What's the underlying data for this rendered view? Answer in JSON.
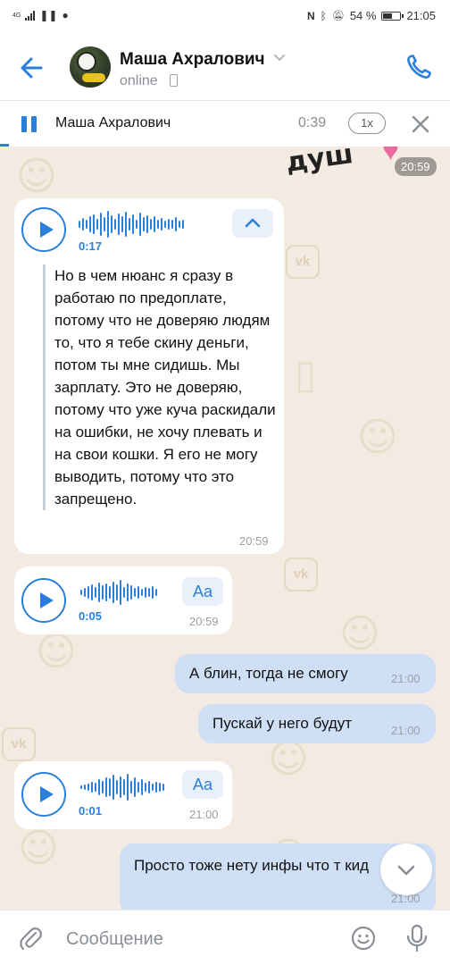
{
  "statusbar": {
    "network_label": "4G",
    "battery": "54 %",
    "battery_level": 0.54,
    "time": "21:05"
  },
  "header": {
    "contact_name": "Маша Ахралович",
    "status": "online"
  },
  "player": {
    "name": "Маша Ахралович",
    "time": "0:39",
    "speed": "1x",
    "progress": 0.02
  },
  "chat": {
    "sticker": {
      "text": "душ",
      "time": "20:59"
    },
    "messages": [
      {
        "type": "voice",
        "direction": "in",
        "duration": "0:17",
        "transcript": "Но в чем нюанс я сразу в работаю по предоплате, потому что не доверяю людям то, что я тебе скину деньги, потом ты мне сидишь. Мы зарплату. Это не доверяю, потому что уже куча раскидали на ошибки, не хочу плевать и на свои кошки. Я его не могу выводить, потому что это запрещено.",
        "time": "20:59"
      },
      {
        "type": "voice",
        "direction": "in",
        "duration": "0:05",
        "aa_label": "Aa",
        "time": "20:59"
      },
      {
        "type": "text",
        "direction": "out",
        "text": "А блин, тогда не смогу",
        "time": "21:00"
      },
      {
        "type": "text",
        "direction": "out",
        "text": "Пускай у него будут",
        "time": "21:00"
      },
      {
        "type": "voice",
        "direction": "in",
        "duration": "0:01",
        "aa_label": "Aa",
        "time": "21:00"
      },
      {
        "type": "text",
        "direction": "out",
        "text": "Просто тоже нету инфы что т кид",
        "time": "21:00"
      }
    ]
  },
  "input": {
    "placeholder": "Сообщение"
  },
  "colors": {
    "accent": "#2a80d9",
    "chat_background": "#f3ebe1",
    "outgoing_bubble": "#cfe0f6",
    "incoming_bubble": "#ffffff"
  }
}
